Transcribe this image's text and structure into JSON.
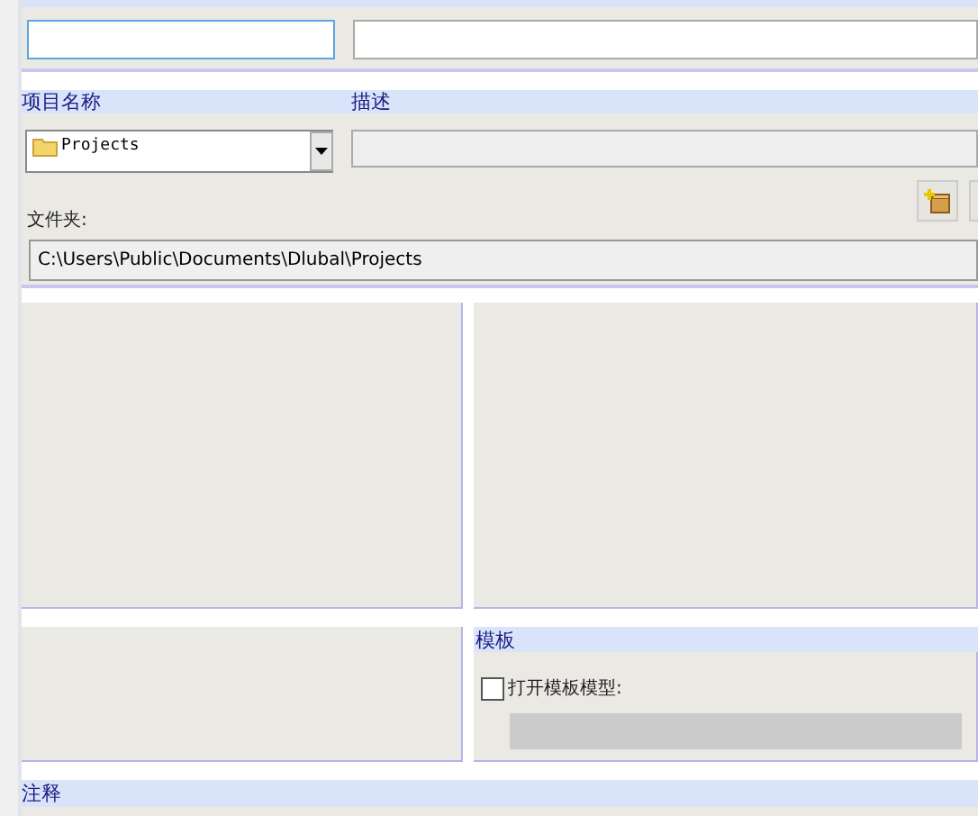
{
  "model": {
    "name_field": {
      "focused": true
    }
  },
  "project": {
    "name_header": "项目名称",
    "description_header": "描述",
    "combo": {
      "value": "Projects"
    },
    "folder_label": "文件夹:",
    "folder_path": "C:\\Users\\Public\\Documents\\Dlubal\\Projects"
  },
  "template": {
    "header": "模板",
    "open_template": {
      "label": "打开模板模型:",
      "checked": false
    }
  },
  "notes": {
    "header": "注释"
  }
}
